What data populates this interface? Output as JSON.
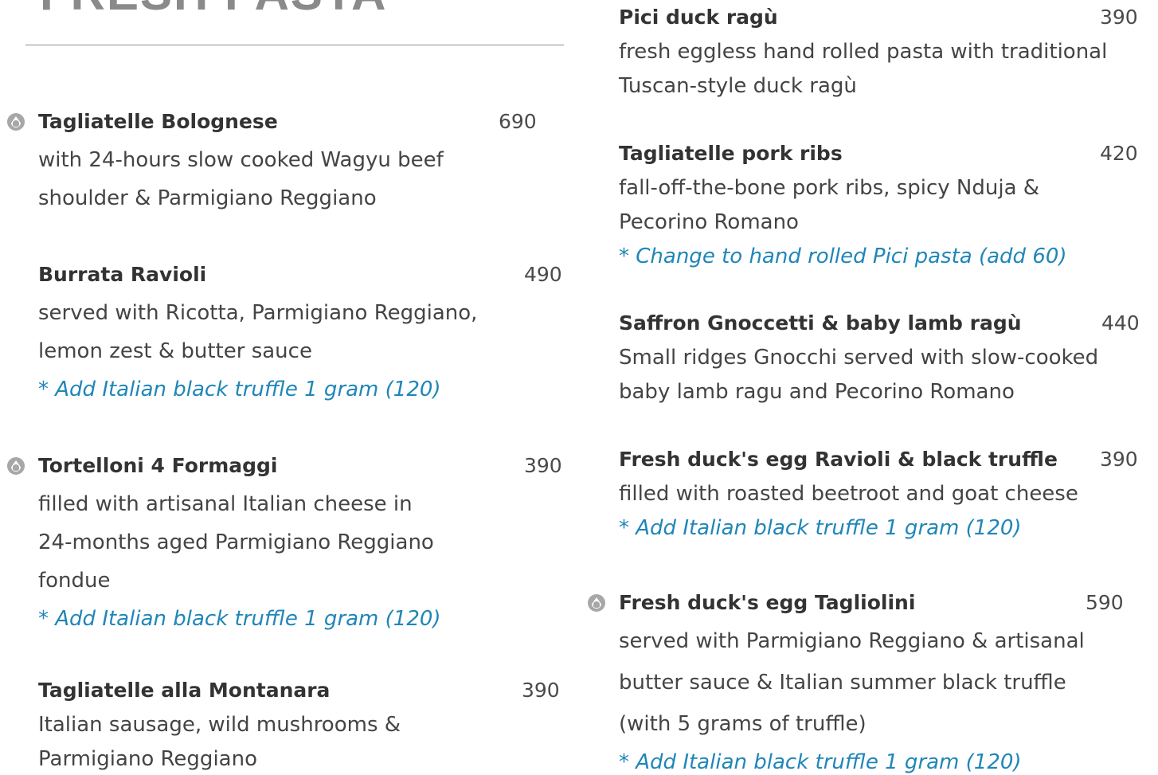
{
  "section": {
    "title": "FRESH PASTA"
  },
  "left_column": [
    {
      "name": "Tagliatelle Bolognese",
      "price": "690",
      "icon": "vegetarian-leaf-icon",
      "description": [
        "with 24-hours slow cooked Wagyu beef",
        "shoulder & Parmigiano Reggiano"
      ],
      "note": ""
    },
    {
      "name": "Burrata Ravioli",
      "price": "490",
      "icon": "",
      "description": [
        "served with Ricotta, Parmigiano Reggiano,",
        "lemon zest & butter sauce"
      ],
      "note": "* Add Italian black truffle 1 gram (120)"
    },
    {
      "name": "Tortelloni 4 Formaggi",
      "price": "390",
      "icon": "vegetarian-leaf-icon",
      "description": [
        "filled with artisanal Italian cheese in",
        "24-months aged Parmigiano Reggiano",
        "fondue"
      ],
      "note": "* Add Italian black truffle 1 gram (120)"
    },
    {
      "name": "Tagliatelle alla Montanara",
      "price": "390",
      "icon": "",
      "description": [
        "Italian sausage, wild mushrooms &",
        "Parmigiano Reggiano"
      ],
      "note": ""
    }
  ],
  "right_column": [
    {
      "name": "Pici duck ragù",
      "price": "390",
      "icon": "",
      "description": [
        "fresh eggless hand rolled pasta with traditional",
        "Tuscan-style duck ragù"
      ],
      "note": ""
    },
    {
      "name": "Tagliatelle pork ribs",
      "price": "420",
      "icon": "",
      "description": [
        "fall-off-the-bone pork ribs, spicy Nduja &",
        "Pecorino Romano"
      ],
      "note": "* Change to hand rolled Pici pasta (add 60)"
    },
    {
      "name": "Saffron Gnoccetti & baby lamb ragù",
      "price": "440",
      "icon": "",
      "description": [
        "Small ridges Gnocchi served with slow-cooked",
        "baby lamb ragu and Pecorino Romano"
      ],
      "note": ""
    },
    {
      "name": "Fresh duck's egg Ravioli & black truffle",
      "price": "390",
      "icon": "",
      "description": [
        "filled with roasted beetroot and goat cheese"
      ],
      "note": "* Add Italian black truffle 1 gram (120)"
    },
    {
      "name": "Fresh duck's egg Tagliolini",
      "price": "590",
      "icon": "vegetarian-leaf-icon",
      "description": [
        "served with Parmigiano Reggiano & artisanal",
        "butter sauce & Italian summer black truffle",
        "(with 5 grams of truffle)"
      ],
      "note": "* Add Italian black truffle 1 gram (120)"
    }
  ],
  "colors": {
    "heading": "#8a8a8a",
    "note": "#1f86b8",
    "icon": "#a7a7a7"
  }
}
